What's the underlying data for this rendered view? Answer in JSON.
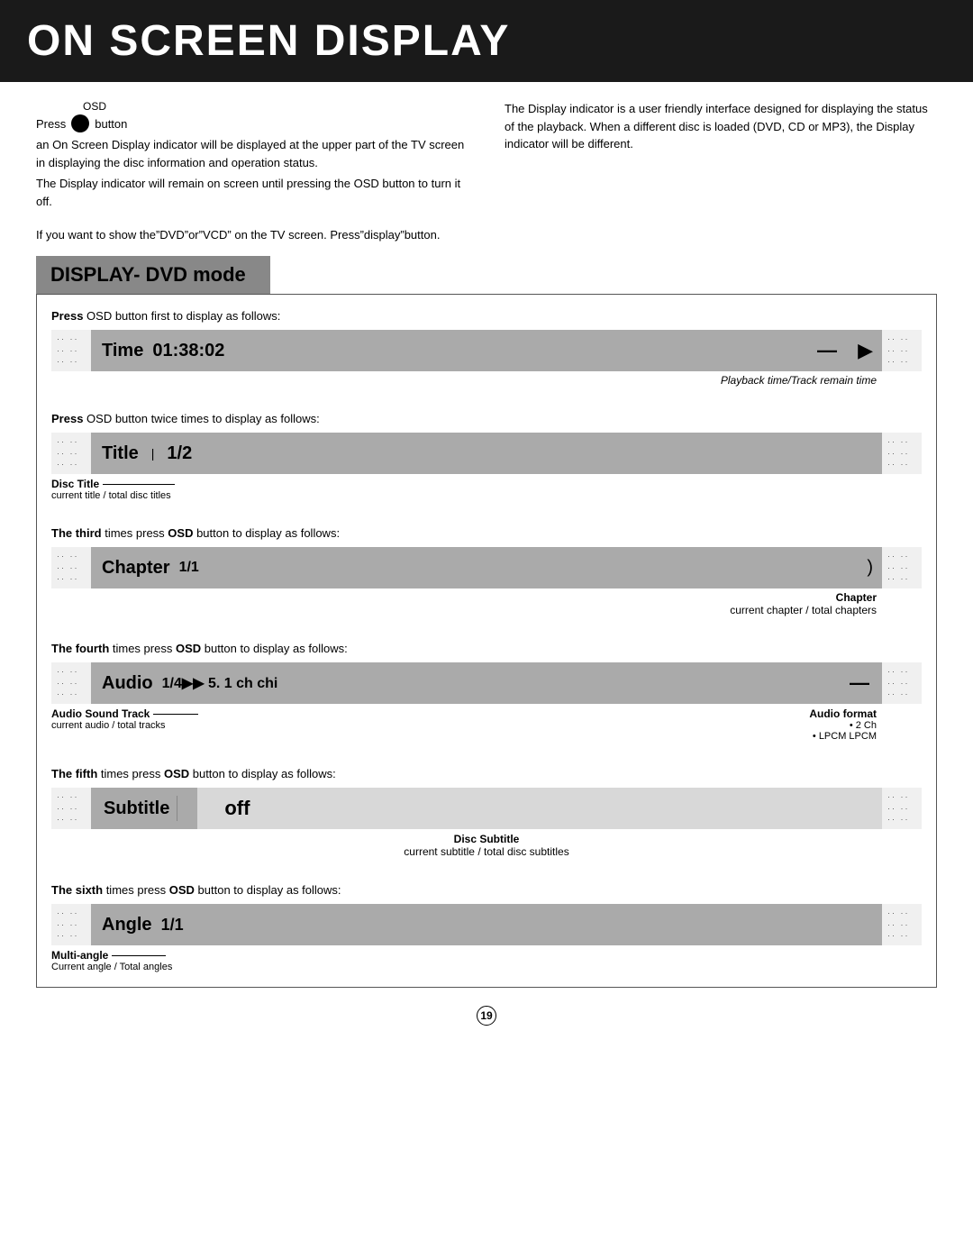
{
  "header": {
    "title": "ON SCREEN DISPLAY"
  },
  "intro": {
    "osd_label": "OSD",
    "press_text": "Press",
    "button_label": "button",
    "left_para1": "an On Screen Display indicator will be displayed at the upper part of the TV screen in displaying the disc information and operation status.",
    "left_para2": "The Display indicator will remain on screen until pressing the OSD button to turn it off.",
    "right_para1": "The Display indicator  is a user friendly interface designed for displaying  the status of  the playback. When a different disc is  loaded (DVD, CD or MP3), the Display indicator will be different.",
    "if_note": "If you want to show the”DVD”or”VCD” on the TV screen. Press”display”button."
  },
  "display_dvd": {
    "section_title": "DISPLAY- DVD mode",
    "rows": [
      {
        "id": "row1",
        "instruction": "Press OSD button first  to display as follows:",
        "bar_label": "Time",
        "bar_value": "01:38:02",
        "has_arrow": true,
        "right_annotation": "Playback time/Track remain time",
        "left_annotation": "",
        "left_sub": ""
      },
      {
        "id": "row2",
        "instruction": "Press OSD button twice times  to display as follows:",
        "bar_label": "Title",
        "bar_value": "1/2",
        "has_arrow": false,
        "right_annotation": "",
        "left_annotation": "Disc Title",
        "left_sub": "current title / total disc titles"
      },
      {
        "id": "row3",
        "instruction": "The third  times press OSD button  to display as follows:",
        "bar_label": "Chapter",
        "bar_value": "1/1",
        "has_arrow": false,
        "right_annotation": "",
        "left_annotation": "",
        "left_sub": "",
        "right_label": "Chapter",
        "right_sub": "current chapter / total chapters"
      },
      {
        "id": "row4",
        "instruction": "The fourth  times press OSD button  to display as follows:",
        "bar_label": "Audio",
        "bar_value": "1/4►► 5. 1  ch  chi",
        "has_arrow": true,
        "right_annotation": "",
        "left_annotation": "Audio Sound  Track",
        "left_sub": "current audio / total tracks",
        "right_label": "Audio format",
        "right_sub": "• 2 Ch\n• LPCM  LPCM"
      },
      {
        "id": "row5",
        "instruction": "The fifth  times press OSD button  to display as follows:",
        "bar_label": "Subtitle",
        "bar_value": "off",
        "is_subtitle": true,
        "has_arrow": false,
        "right_annotation": "",
        "left_annotation": "",
        "left_sub": "",
        "center_label": "Disc Subtitle",
        "center_sub": "current subtitle / total disc subtitles"
      },
      {
        "id": "row6",
        "instruction": "The sixth  times press OSD button  to display as follows:",
        "bar_label": "Angle",
        "bar_value": "1/1",
        "has_arrow": false,
        "right_annotation": "",
        "left_annotation": "Multi-angle",
        "left_sub": "Current angle / Total angles"
      }
    ]
  },
  "page_number": "19"
}
